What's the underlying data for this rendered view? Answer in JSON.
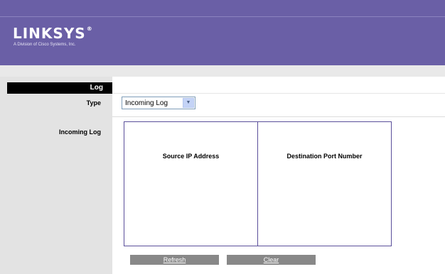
{
  "brand": {
    "name": "Linksys",
    "name_display": "LINKSYS",
    "registered_mark": "®",
    "tagline": "A Division of Cisco Systems, Inc."
  },
  "sidebar": {
    "section_title": "Log",
    "type_label": "Type",
    "incoming_log_label": "Incoming Log"
  },
  "type_select": {
    "selected": "Incoming Log",
    "arrow_icon": "chevron-down-icon"
  },
  "log_table": {
    "columns": [
      "Source IP Address",
      "Destination Port Number"
    ],
    "rows": []
  },
  "buttons": {
    "refresh": "Refresh",
    "clear": "Clear"
  },
  "colors": {
    "header_bg": "#6a5fa6",
    "table_border": "#5a4f9a",
    "button_bg": "#888888"
  }
}
